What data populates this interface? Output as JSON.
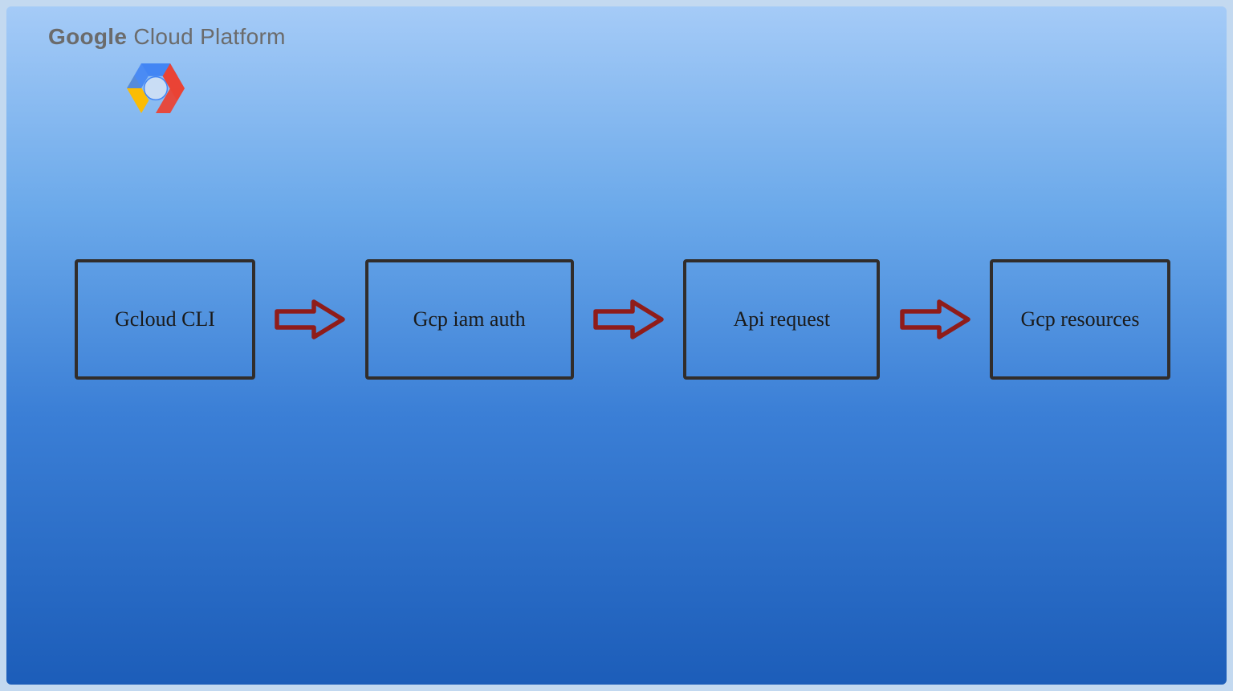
{
  "header": {
    "title_bold": "Google",
    "title_rest": " Cloud Platform"
  },
  "logo": {
    "name": "gcp-hexagon-icon"
  },
  "flow": {
    "nodes": [
      {
        "label": "Gcloud CLI"
      },
      {
        "label": "Gcp iam auth"
      },
      {
        "label": "Api request"
      },
      {
        "label": "Gcp resources"
      }
    ],
    "arrow_color_stroke": "#8f1c1a",
    "arrow_color_fill": "#3b7fd6",
    "node_border_color": "#312d2b"
  }
}
